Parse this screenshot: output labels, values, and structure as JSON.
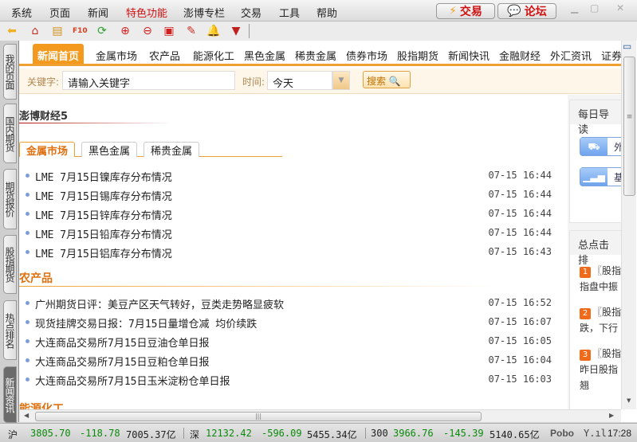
{
  "menu": [
    "系统",
    "页面",
    "新闻",
    "特色功能",
    "澎博专栏",
    "交易",
    "工具",
    "帮助"
  ],
  "top_buttons": {
    "trade": "交易",
    "forum": "论坛"
  },
  "toolbar_icons": [
    "back-arrow-icon",
    "home-icon",
    "notes-icon",
    "f10-icon",
    "refresh-icon",
    "zoom-in-icon",
    "zoom-out-icon",
    "windows-icon",
    "pen-icon",
    "bell-icon",
    "filter-icon"
  ],
  "side_tabs": [
    "我的页面",
    "国内期货",
    "期货报价",
    "股指期货",
    "热点排名",
    "新闻资讯"
  ],
  "nav_tabs": [
    "新闻首页",
    "金属市场",
    "农产品",
    "能源化工",
    "黑色金属",
    "稀贵金属",
    "债券市场",
    "股指期货",
    "新闻快讯",
    "金融财经",
    "外汇资讯",
    "证券"
  ],
  "search": {
    "keyword_label": "关键字:",
    "keyword_placeholder": "请输入关键字",
    "time_label": "时间:",
    "time_value": "今天",
    "search_btn": "搜索"
  },
  "main": {
    "title": "澎博财经5",
    "sub_tabs": [
      "金属市场",
      "黑色金属",
      "稀贵金属"
    ],
    "metal_news": [
      {
        "t": "LME 7月15日镍库存分布情况",
        "d": "07-15 16:44"
      },
      {
        "t": "LME 7月15日锡库存分布情况",
        "d": "07-15 16:44"
      },
      {
        "t": "LME 7月15日锌库存分布情况",
        "d": "07-15 16:44"
      },
      {
        "t": "LME 7月15日铅库存分布情况",
        "d": "07-15 16:44"
      },
      {
        "t": "LME 7月15日铝库存分布情况",
        "d": "07-15 16:43"
      }
    ],
    "agri_title": "农产品",
    "agri_news": [
      {
        "t": "广州期货日评：美豆产区天气转好，豆类走势略显疲软",
        "d": "07-15 16:52"
      },
      {
        "t": "现货挂牌交易日报：7月15日量增仓减 均价续跌",
        "d": "07-15 16:07"
      },
      {
        "t": "大连商品交易所7月15日豆油仓单日报",
        "d": "07-15 16:05"
      },
      {
        "t": "大连商品交易所7月15日豆粕仓单日报",
        "d": "07-15 16:04"
      },
      {
        "t": "大连商品交易所7月15日玉米淀粉仓单日报",
        "d": "07-15 16:03"
      }
    ],
    "energy_title": "能源化工"
  },
  "right": {
    "daily_title": "每日导读",
    "daily_items": [
      "外",
      "基"
    ],
    "rank_title": "总点击排",
    "rank": [
      {
        "n": "1",
        "t": "〖股指",
        "t2": "指盘中振"
      },
      {
        "n": "2",
        "t": "〖股指",
        "t2": "跌，下行"
      },
      {
        "n": "3",
        "t": "〖股指",
        "t2": "昨日股指",
        "t3": "翘"
      }
    ]
  },
  "status": {
    "sh_label": "沪",
    "sh_idx": "3805.70",
    "sh_chg": "-118.78",
    "sh_amt": "7005.37亿",
    "sz_label": "深",
    "sz_idx": "12132.42",
    "sz_chg": "-596.09",
    "sz_amt": "5455.34亿",
    "hs_label": "300",
    "hs_idx": "3966.76",
    "hs_chg": "-145.39",
    "hs_amt": "5140.65亿",
    "brand": "Pobo",
    "time": "17:28"
  }
}
